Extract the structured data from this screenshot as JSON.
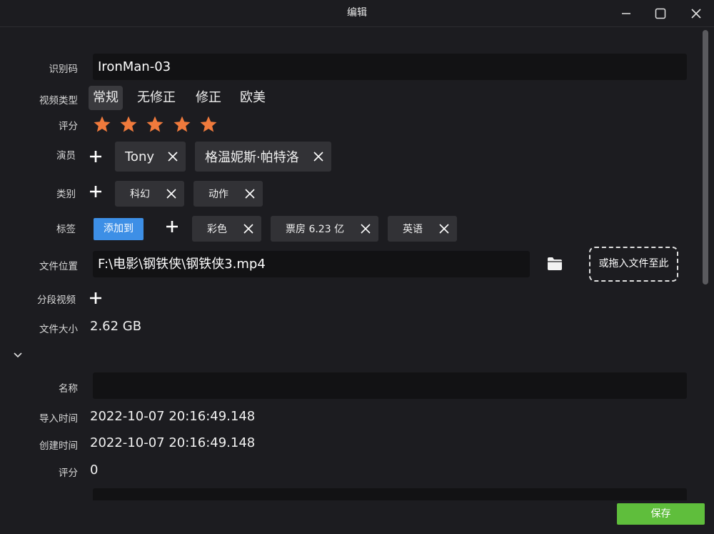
{
  "window": {
    "title": "编辑"
  },
  "fields": {
    "id_code": {
      "label": "识别码",
      "value": "IronMan-03"
    },
    "video_type": {
      "label": "视频类型",
      "options": [
        "常规",
        "无修正",
        "修正",
        "欧美"
      ],
      "selected": "常规"
    },
    "rating": {
      "label": "评分",
      "stars": 5,
      "max": 5,
      "color": "#f07a3c"
    },
    "actors": {
      "label": "演员",
      "items": [
        "Tony",
        "格温妮斯·帕特洛"
      ]
    },
    "genres": {
      "label": "类别",
      "items": [
        "科幻",
        "动作"
      ]
    },
    "tags": {
      "label": "标签",
      "add_to_label": "添加到",
      "items": [
        "彩色",
        "票房 6.23 亿",
        "英语"
      ]
    },
    "file_location": {
      "label": "文件位置",
      "value": "F:\\电影\\钢铁侠\\钢铁侠3.mp4",
      "drop_label": "或拖入文件至此"
    },
    "segments": {
      "label": "分段视频"
    },
    "file_size": {
      "label": "文件大小",
      "value": "2.62 GB"
    },
    "name": {
      "label": "名称",
      "value": ""
    },
    "import_time": {
      "label": "导入时间",
      "value": "2022-10-07 20:16:49.148"
    },
    "create_time": {
      "label": "创建时间",
      "value": "2022-10-07 20:16:49.148"
    },
    "score": {
      "label": "评分",
      "value": "0"
    }
  },
  "actions": {
    "save": "保存"
  },
  "colors": {
    "accent_blue": "#3d8fe6",
    "save_green": "#5fbe3c",
    "star": "#f07a3c"
  }
}
